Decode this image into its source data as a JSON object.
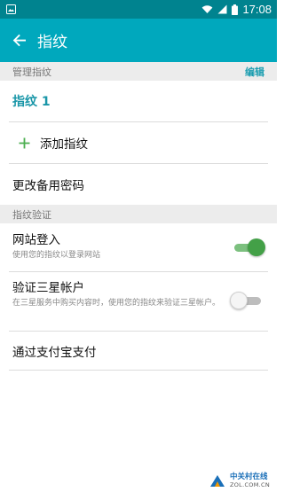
{
  "status_bar": {
    "time": "17:08"
  },
  "app_bar": {
    "title": "指纹"
  },
  "sections": {
    "manage": {
      "title": "管理指纹",
      "edit": "编辑"
    },
    "verify": {
      "title": "指纹验证"
    }
  },
  "manage_items": {
    "fingerprint": "指纹 1",
    "add": "添加指纹",
    "backup_password": "更改备用密码"
  },
  "verify_items": [
    {
      "title": "网站登入",
      "desc": "使用您的指纹以登录网站",
      "enabled": true
    },
    {
      "title": "验证三星帐户",
      "desc": "在三星服务中购买内容时，使用您的指纹来验证三星帐户。",
      "enabled": false
    },
    {
      "title": "通过支付宝支付"
    }
  ],
  "watermark": {
    "cn": "中关村在线",
    "en": "ZOL.COM.CN"
  },
  "colors": {
    "status_bar": "#00838f",
    "app_bar": "#00a8bd",
    "accent": "#1996a8",
    "toggle_on": "#43a047"
  },
  "icons": {
    "status_left": "image-notification-icon",
    "status_right": [
      "wifi-icon",
      "signal-icon",
      "battery-icon"
    ],
    "back": "arrow-back-icon",
    "add": "plus-icon"
  }
}
